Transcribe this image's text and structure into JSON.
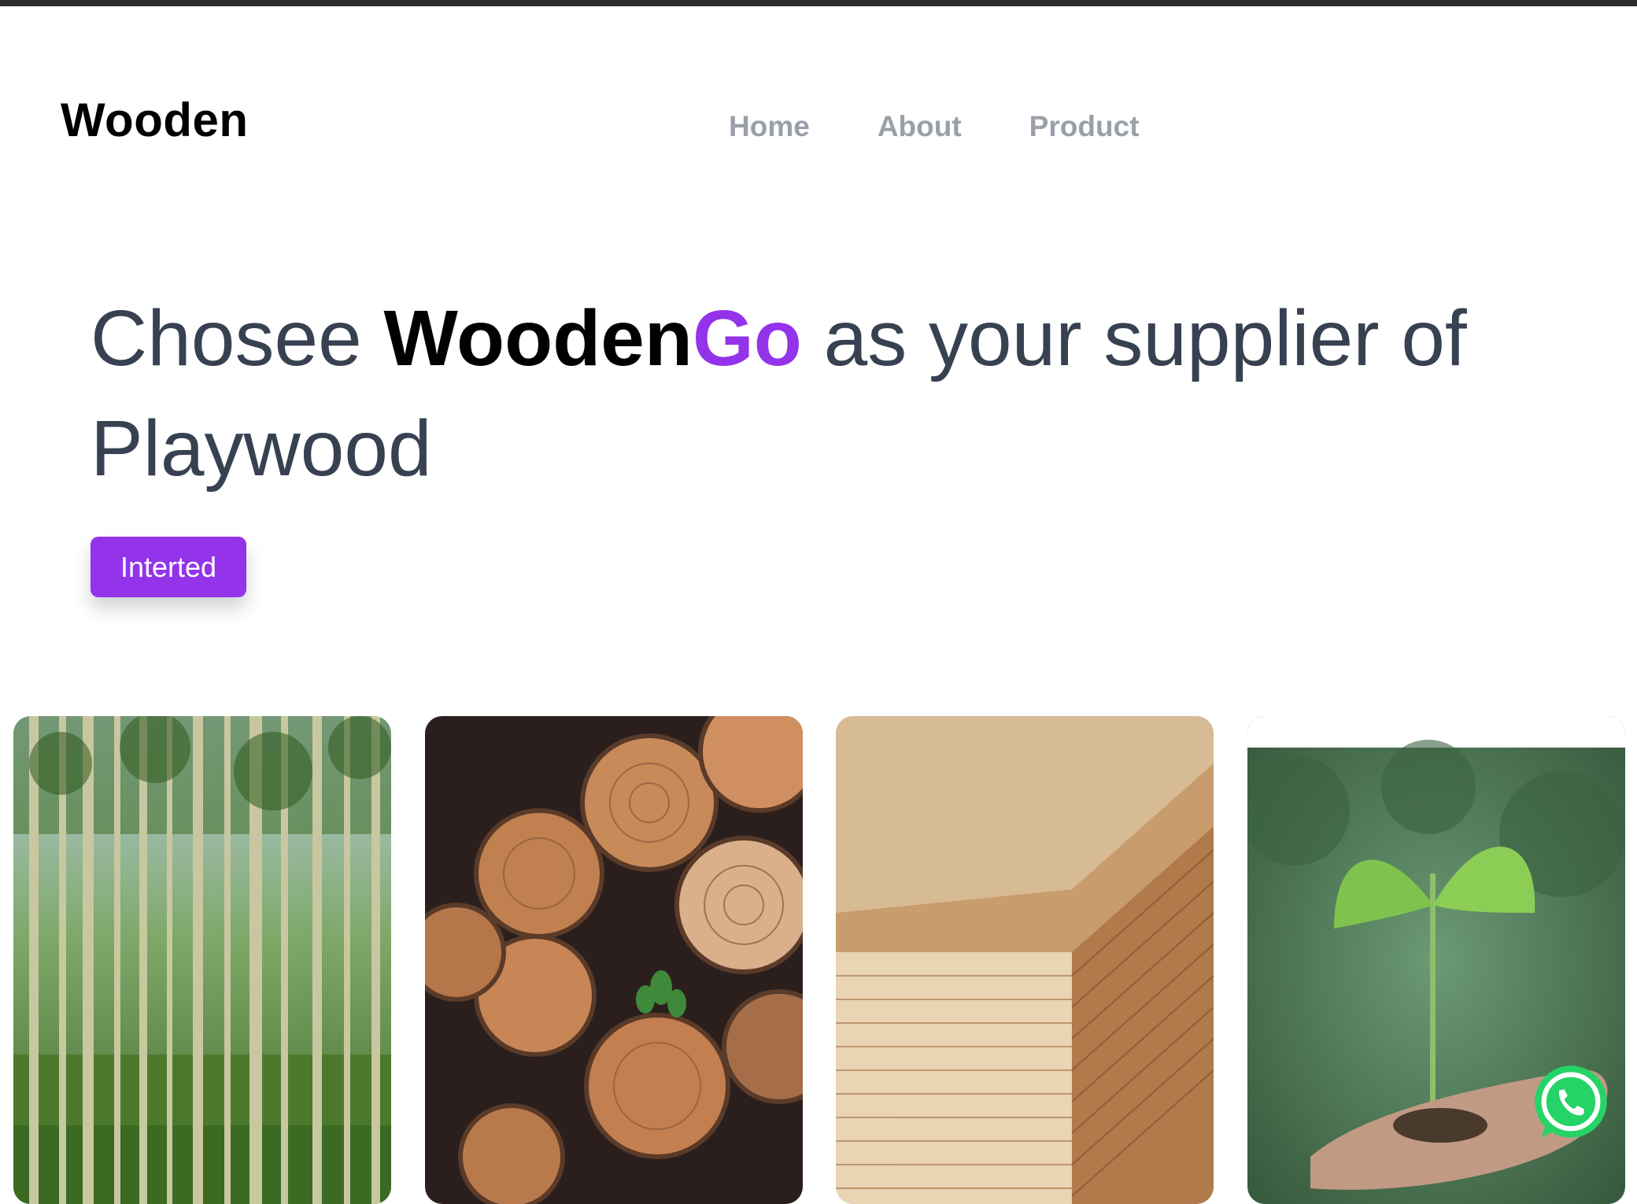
{
  "header": {
    "logo": "Wooden",
    "nav": [
      {
        "label": "Home"
      },
      {
        "label": "About"
      },
      {
        "label": "Product"
      }
    ]
  },
  "hero": {
    "headline_start": "Chosee ",
    "brand_main": "Wooden",
    "brand_accent": "Go",
    "headline_end": " as your supplier of Playwood",
    "cta_label": "Interted"
  },
  "gallery": {
    "images": [
      {
        "icon": "forest-image"
      },
      {
        "icon": "logs-image"
      },
      {
        "icon": "plywood-stack-image"
      },
      {
        "icon": "seedling-hand-image"
      }
    ]
  },
  "floating": {
    "icon": "whatsapp-icon"
  },
  "colors": {
    "accent": "#9333ea",
    "heading": "#374151",
    "nav": "#9aa0aa",
    "whatsapp": "#25D366"
  }
}
